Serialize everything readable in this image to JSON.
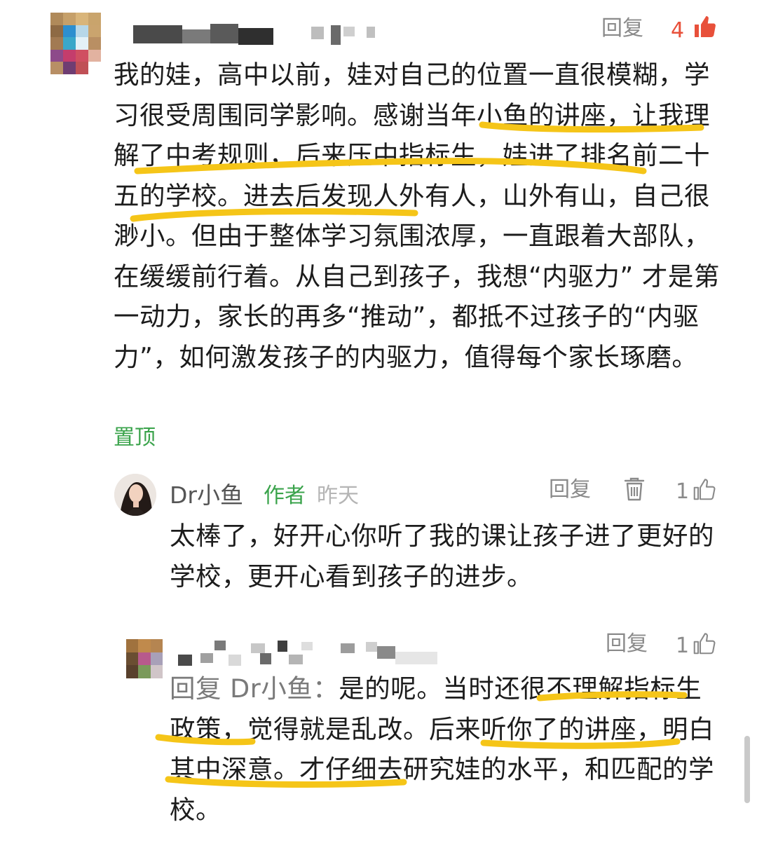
{
  "comment": {
    "reply_label": "回复",
    "like_count": "4",
    "text": "我的娃，高中以前，娃对自己的位置一直很模糊，学习很受周围同学影响。感谢当年小鱼的讲座，让我理解了中考规则，后来压中指标生，娃进了排名前二十五的学校。进去后发现人外有人，山外有山，自己很渺小。但由于整体学习氛围浓厚，一直跟着大部队，在缓缓前行着。从自己到孩子，我想“内驱力” 才是第一动力，家长的再多“推动”，都抵不过孩子的“内驱力”，如何激发孩子的内驱力，值得每个家长琢磨。",
    "pinned_label": "置顶"
  },
  "author_reply": {
    "name": "Dr小鱼",
    "tag": "作者",
    "time": "昨天",
    "reply_label": "回复",
    "like_count": "1",
    "text": "太棒了，好开心你听了我的课让孩子进了更好的学校，更开心看到孩子的进步。"
  },
  "user_reply": {
    "reply_label": "回复",
    "like_count": "1",
    "prefix": "回复 Dr小鱼：",
    "text": "是的呢。当时还很不理解指标生政策，觉得就是乱改。后来听你了的讲座，明白其中深意。才仔细去研究娃的水平，和匹配的学校。"
  },
  "colors": {
    "highlight": "#f5c518",
    "author_tag": "#3aa34b",
    "like_active": "#e8503a"
  },
  "icons": [
    "thumbs-up-icon",
    "trash-icon"
  ]
}
